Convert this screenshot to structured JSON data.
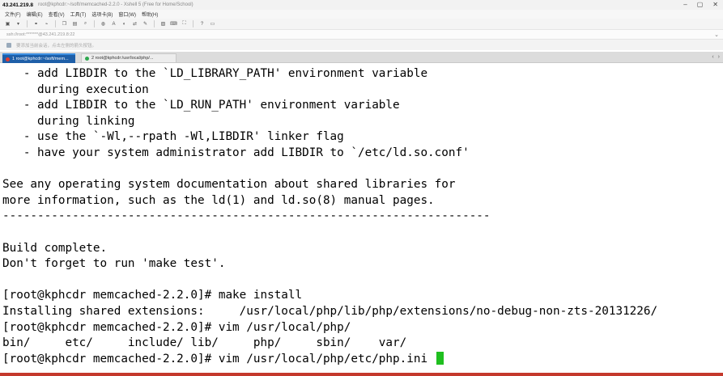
{
  "window": {
    "ip": "43.241.219.8",
    "title": "root@kphcdr:~/soft/memcached-2.2.0 - Xshell 5 (Free for Home/School)"
  },
  "menu": [
    "文件(F)",
    "编辑(E)",
    "查看(V)",
    "工具(T)",
    "选项卡(B)",
    "窗口(W)",
    "帮助(H)"
  ],
  "addressbar": {
    "text": "ssh://root:*******@43.241.219.8:22"
  },
  "hintbar": {
    "text": "要添加当前会话，点击左侧的箭头按钮。"
  },
  "tabs": [
    {
      "label": "1 root@kphcdr:~/soft/mem...",
      "active": true,
      "color": "#e03c31"
    },
    {
      "label": "2 root@kphcdr:/usr/local/php/...",
      "active": false,
      "color": "#2fa84f"
    }
  ],
  "terminal": {
    "lines": [
      "   - add LIBDIR to the `LD_LIBRARY_PATH' environment variable",
      "     during execution",
      "   - add LIBDIR to the `LD_RUN_PATH' environment variable",
      "     during linking",
      "   - use the `-Wl,--rpath -Wl,LIBDIR' linker flag",
      "   - have your system administrator add LIBDIR to `/etc/ld.so.conf'",
      "",
      "See any operating system documentation about shared libraries for",
      "more information, such as the ld(1) and ld.so(8) manual pages.",
      "----------------------------------------------------------------------",
      "",
      "Build complete.",
      "Don't forget to run 'make test'.",
      "",
      "[root@kphcdr memcached-2.2.0]# make install",
      "Installing shared extensions:     /usr/local/php/lib/php/extensions/no-debug-non-zts-20131226/",
      "[root@kphcdr memcached-2.2.0]# vim /usr/local/php/",
      "bin/     etc/     include/ lib/     php/     sbin/    var/",
      "[root@kphcdr memcached-2.2.0]# vim /usr/local/php/etc/php.ini "
    ],
    "cursor_color": "#1fbf1f"
  },
  "colors": {
    "tab_active_bg": "#1e5fa8",
    "bottom_rule": "#c4392c"
  }
}
